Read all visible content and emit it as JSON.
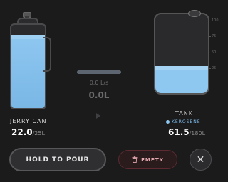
{
  "jerry_can": {
    "label": "JERRY CAN",
    "value": "22.0",
    "max": "/25L",
    "fill_percent": 88
  },
  "flow": {
    "rate": "0.0 L/s",
    "volume": "0.0L"
  },
  "tank": {
    "label": "TANK",
    "fuel": "KEROSENE",
    "value": "61.5",
    "max": "/180L",
    "fill_percent": 34,
    "scale": [
      "100",
      "75",
      "50",
      "25"
    ]
  },
  "buttons": {
    "pour": "HOLD TO POUR",
    "empty": "EMPTY",
    "close": "✕"
  },
  "colors": {
    "fuel": "#8ec7f0",
    "danger": "#e2a6ac",
    "background": "#1b1b1c"
  }
}
